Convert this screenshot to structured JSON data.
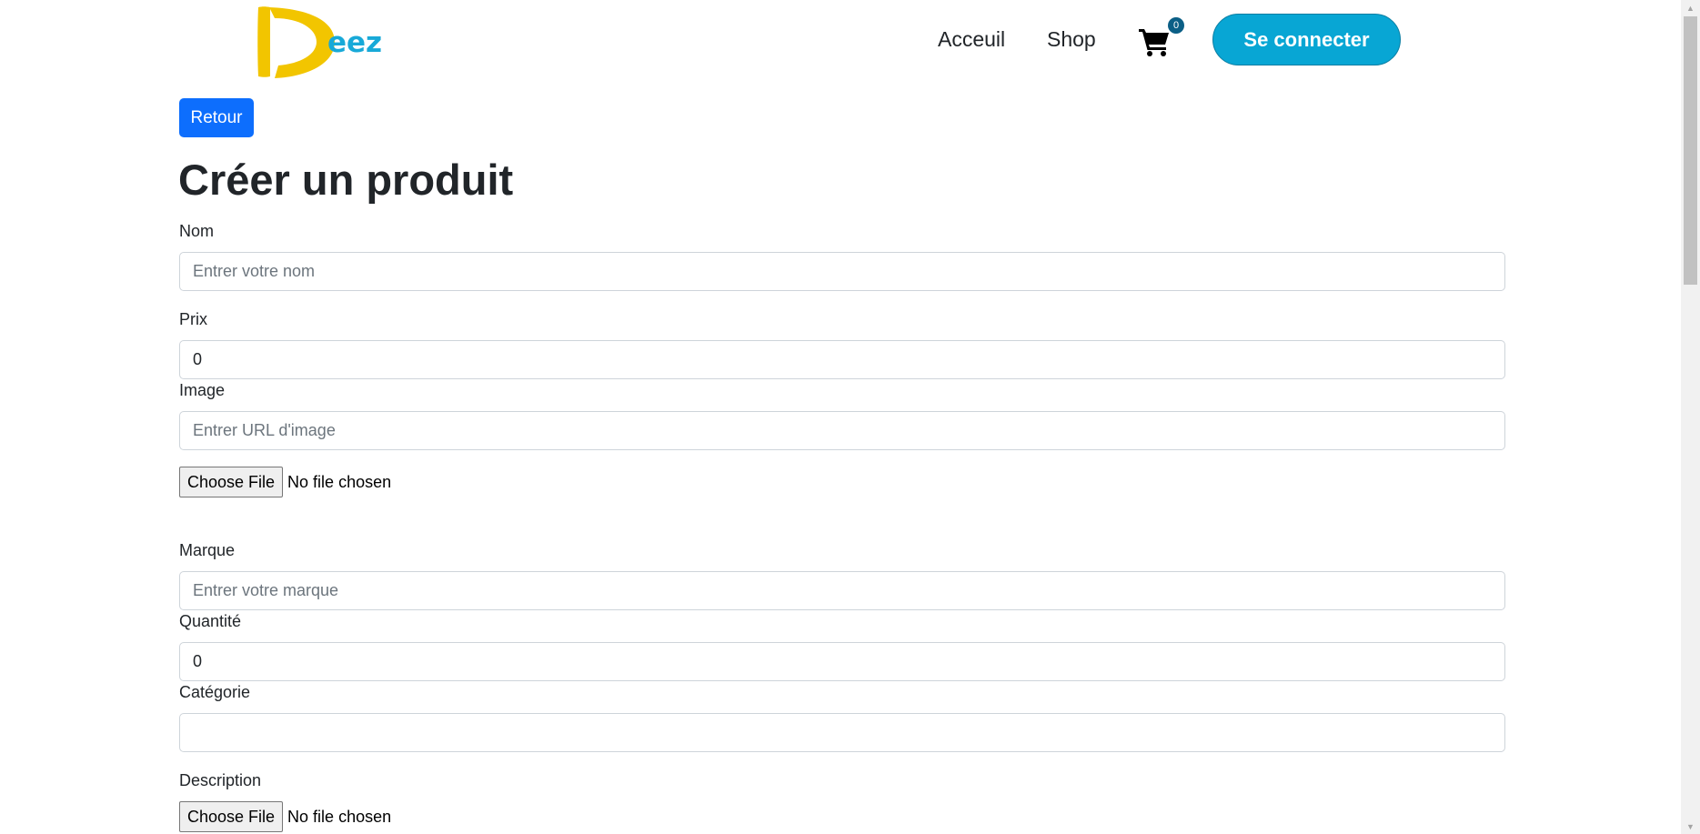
{
  "header": {
    "logo_text": "Deez",
    "nav": [
      "Acceuil",
      "Shop"
    ],
    "cart_count": "0",
    "login_label": "Se connecter",
    "colors": {
      "logo_yellow": "#f2c500",
      "logo_blue": "#18a9d8",
      "login_bg": "#08a6d4",
      "badge": "#0b5f86"
    }
  },
  "back_label": "Retour",
  "title": "Créer un produit",
  "form": {
    "nom": {
      "label": "Nom",
      "value": "",
      "placeholder": "Entrer votre nom"
    },
    "prix": {
      "label": "Prix",
      "value": "0",
      "placeholder": ""
    },
    "image": {
      "label": "Image",
      "value": "",
      "placeholder": "Entrer URL d'image"
    },
    "image_file": {
      "button": "Choose File",
      "status": "No file chosen"
    },
    "marque": {
      "label": "Marque",
      "value": "",
      "placeholder": "Entrer votre marque"
    },
    "quantite": {
      "label": "Quantité",
      "value": "0",
      "placeholder": ""
    },
    "categorie": {
      "label": "Catégorie",
      "value": "",
      "placeholder": ""
    },
    "description": {
      "label": "Description"
    },
    "description_file": {
      "button": "Choose File",
      "status": "No file chosen"
    }
  },
  "accent": "#0d6efd"
}
